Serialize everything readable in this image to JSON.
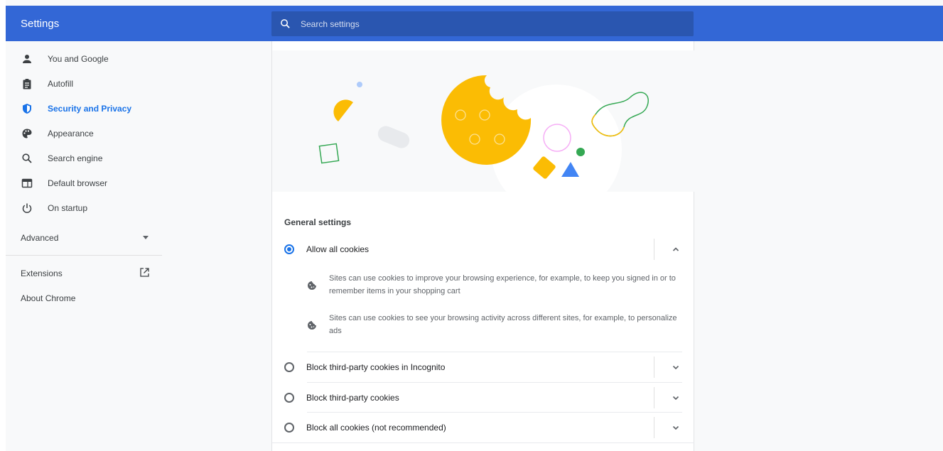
{
  "app": {
    "title": "Settings"
  },
  "search": {
    "placeholder": "Search settings"
  },
  "sidebar": {
    "items": [
      {
        "label": "You and Google",
        "icon": "person-icon"
      },
      {
        "label": "Autofill",
        "icon": "clipboard-icon"
      },
      {
        "label": "Security and Privacy",
        "icon": "shield-icon",
        "active": true
      },
      {
        "label": "Appearance",
        "icon": "palette-icon"
      },
      {
        "label": "Search engine",
        "icon": "search-icon"
      },
      {
        "label": "Default browser",
        "icon": "browser-icon"
      },
      {
        "label": "On startup",
        "icon": "power-icon"
      }
    ],
    "advanced": "Advanced",
    "extensions": "Extensions",
    "about": "About Chrome"
  },
  "main": {
    "section_title": "General settings",
    "options": [
      {
        "label": "Allow all cookies",
        "selected": true,
        "expanded": true,
        "details": [
          "Sites can use cookies to improve your browsing experience, for example, to keep you signed in or to remember items in your shopping cart",
          "Sites can use cookies to see your browsing activity across different sites, for example, to personalize ads"
        ]
      },
      {
        "label": "Block third-party cookies in Incognito",
        "selected": false
      },
      {
        "label": "Block third-party cookies",
        "selected": false
      },
      {
        "label": "Block all cookies (not recommended)",
        "selected": false
      }
    ]
  },
  "colors": {
    "toolbar": "#3367d6",
    "search": "#2a56b0",
    "accent": "#1a73e8",
    "cookie": "#fbbc04"
  }
}
